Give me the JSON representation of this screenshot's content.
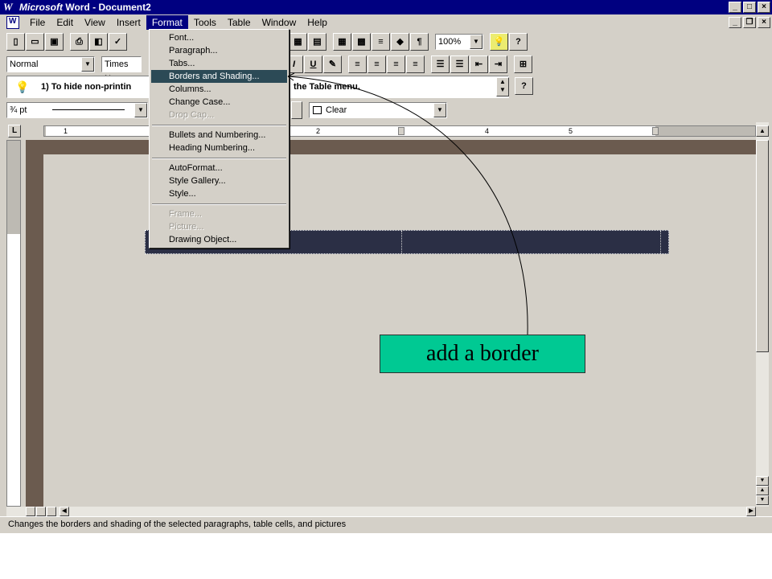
{
  "window": {
    "app_icon": "W",
    "title_brand": "Microsoft",
    "title_rest": "Word - Document2",
    "controls": [
      "_",
      "□",
      "×"
    ]
  },
  "menubar": {
    "items": [
      "File",
      "Edit",
      "View",
      "Insert",
      "Format",
      "Tools",
      "Table",
      "Window",
      "Help"
    ],
    "active": "Format",
    "doc_controls": [
      "_",
      "❐",
      "×"
    ]
  },
  "toolbar_standard": {
    "zoom": "100%"
  },
  "toolbar_formatting": {
    "style": "Normal",
    "font": "Times Ne"
  },
  "tip": {
    "text_left": "1) To hide non-printin",
    "text_right": "the Table menu."
  },
  "borders_toolbar": {
    "line_width": "¾ pt",
    "shading": "Clear"
  },
  "format_menu": {
    "items": [
      {
        "label": "Font...",
        "state": "normal"
      },
      {
        "label": "Paragraph...",
        "state": "normal"
      },
      {
        "label": "Tabs...",
        "state": "normal"
      },
      {
        "label": "Borders and Shading...",
        "state": "selected"
      },
      {
        "label": "Columns...",
        "state": "normal"
      },
      {
        "label": "Change Case...",
        "state": "normal"
      },
      {
        "label": "Drop Cap...",
        "state": "disabled"
      },
      {
        "label": "Bullets and Numbering...",
        "state": "normal"
      },
      {
        "label": "Heading Numbering...",
        "state": "normal"
      },
      {
        "label": "AutoFormat...",
        "state": "normal"
      },
      {
        "label": "Style Gallery...",
        "state": "normal"
      },
      {
        "label": "Style...",
        "state": "normal"
      },
      {
        "label": "Frame...",
        "state": "disabled"
      },
      {
        "label": "Picture...",
        "state": "disabled"
      },
      {
        "label": "Drawing Object...",
        "state": "normal"
      }
    ]
  },
  "ruler": {
    "numbers": [
      "1",
      "2",
      "4",
      "5"
    ]
  },
  "status_bar": {
    "text": "Changes the borders and shading of the selected paragraphs, table cells, and pictures"
  },
  "callout": {
    "text": "add a border",
    "color": "#00c993"
  }
}
